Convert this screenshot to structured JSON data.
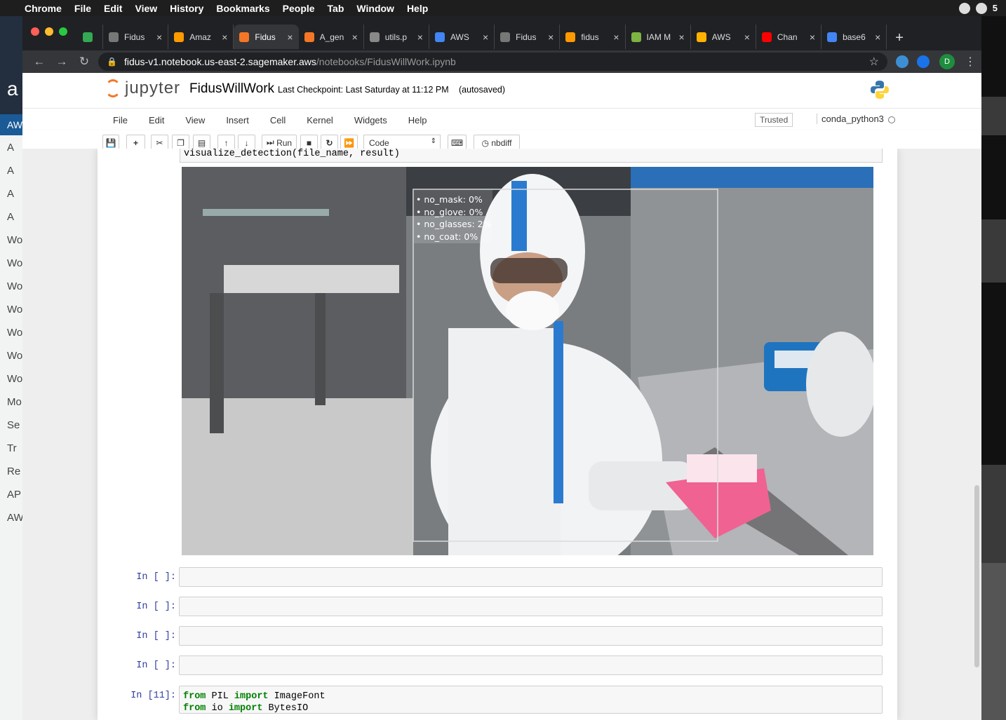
{
  "menubar": {
    "app": "Chrome",
    "items": [
      "File",
      "Edit",
      "View",
      "History",
      "Bookmarks",
      "People",
      "Tab",
      "Window",
      "Help"
    ],
    "badge": "5"
  },
  "background": {
    "aws_logo": "a",
    "aws_band": "AW",
    "sidebar_items": [
      "A",
      "A",
      "A",
      "A",
      "Wo",
      "Wo",
      "Wo",
      "Wo",
      "Wo",
      "Wo",
      "Wo",
      "Mo",
      "Se",
      "Tr",
      "Re",
      "AP",
      "AW"
    ]
  },
  "tabs": [
    {
      "title": "",
      "color": "#34a853"
    },
    {
      "title": "Fidus",
      "color": "#777"
    },
    {
      "title": "Amaz",
      "color": "#ff9900"
    },
    {
      "title": "Fidus",
      "color": "#f37726",
      "active": true
    },
    {
      "title": "A_gen",
      "color": "#f37726"
    },
    {
      "title": "utils.p",
      "color": "#888"
    },
    {
      "title": "AWS",
      "color": "#4285f4"
    },
    {
      "title": "Fidus",
      "color": "#777"
    },
    {
      "title": "fidus",
      "color": "#ff9900"
    },
    {
      "title": "IAM M",
      "color": "#7cb342"
    },
    {
      "title": "AWS",
      "color": "#ffb300"
    },
    {
      "title": "Chan",
      "color": "#ff0000"
    },
    {
      "title": "base6",
      "color": "#4285f4"
    }
  ],
  "address": {
    "host": "fidus-v1.notebook.us-east-2.sagemaker.aws",
    "path": "/notebooks/FidusWillWork.ipynb",
    "profile_initial": "D"
  },
  "jupyter": {
    "logo_text": "jupyter",
    "notebook_name": "FidusWillWork",
    "checkpoint": "Last Checkpoint: Last Saturday at 11:12 PM",
    "autosaved": "(autosaved)",
    "menu": [
      "File",
      "Edit",
      "View",
      "Insert",
      "Cell",
      "Kernel",
      "Widgets",
      "Help"
    ],
    "trusted": "Trusted",
    "kernel": "conda_python3",
    "toolbar": {
      "run": "Run",
      "cell_type": "Code",
      "nbdiff": "nbdiff"
    }
  },
  "cells": {
    "code_line": "visualize_detection(file_name, result)",
    "detection_labels": [
      "• no_mask: 0%",
      "• no_glove: 0%",
      "• no_glasses: 2%",
      "• no_coat: 0%"
    ],
    "empty_prompt": "In [ ]:",
    "last_prompt": "In [11]:",
    "last_code": [
      {
        "kw1": "from",
        "mod": " PIL ",
        "kw2": "import",
        "name": " ImageFont"
      },
      {
        "kw1": "from",
        "mod": " io ",
        "kw2": "import",
        "name": " BytesIO"
      }
    ]
  },
  "colors": {
    "jupyter_orange": "#f37726",
    "prompt_blue": "#303f9f",
    "keyword_green": "#008000"
  }
}
